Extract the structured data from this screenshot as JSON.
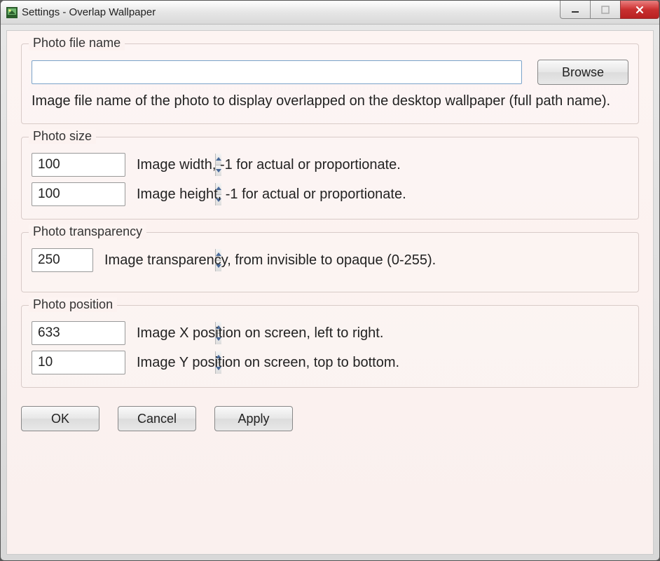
{
  "window": {
    "title": "Settings - Overlap Wallpaper"
  },
  "filename_group": {
    "legend": "Photo file name",
    "value": "",
    "browse_label": "Browse",
    "hint": "Image file name of the photo to display overlapped on the desktop wallpaper (full path name)."
  },
  "size_group": {
    "legend": "Photo size",
    "width_value": "100",
    "width_hint": "Image width, -1 for actual or proportionate.",
    "height_value": "100",
    "height_hint": "Image height, -1 for actual or proportionate."
  },
  "transparency_group": {
    "legend": "Photo transparency",
    "value": "250",
    "hint": "Image transparency, from invisible to opaque (0-255)."
  },
  "position_group": {
    "legend": "Photo position",
    "x_value": "633",
    "x_hint": "Image X position on screen, left to right.",
    "y_value": "10",
    "y_hint": "Image Y position on screen, top to bottom."
  },
  "buttons": {
    "ok": "OK",
    "cancel": "Cancel",
    "apply": "Apply"
  }
}
